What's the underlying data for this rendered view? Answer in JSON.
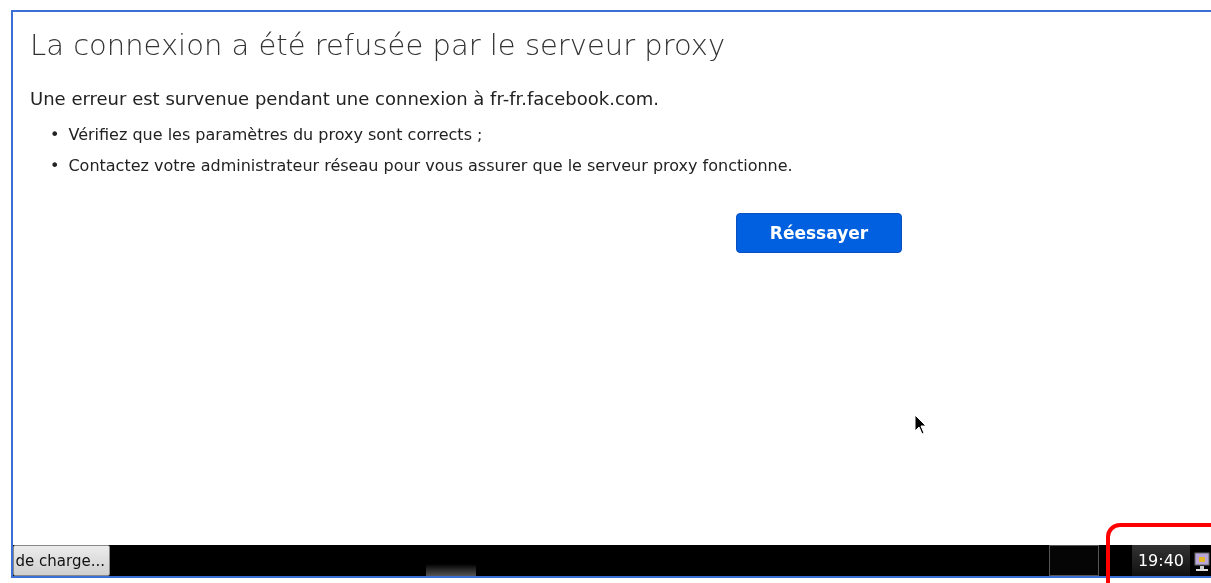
{
  "error_page": {
    "title": "La connexion a été refusée par le serveur proxy",
    "message": "Une erreur est survenue pendant une connexion à fr-fr.facebook.com.",
    "tips": [
      {
        "bullet": "•",
        "text": "Vérifiez que les paramètres du proxy sont corrects ;"
      },
      {
        "bullet": "•",
        "text": "Contactez votre administrateur réseau pour vous assurer que le serveur proxy fonctionne."
      }
    ],
    "retry_button": "Réessayer"
  },
  "taskbar": {
    "task_button": "de charge...",
    "clock": "19:40"
  }
}
